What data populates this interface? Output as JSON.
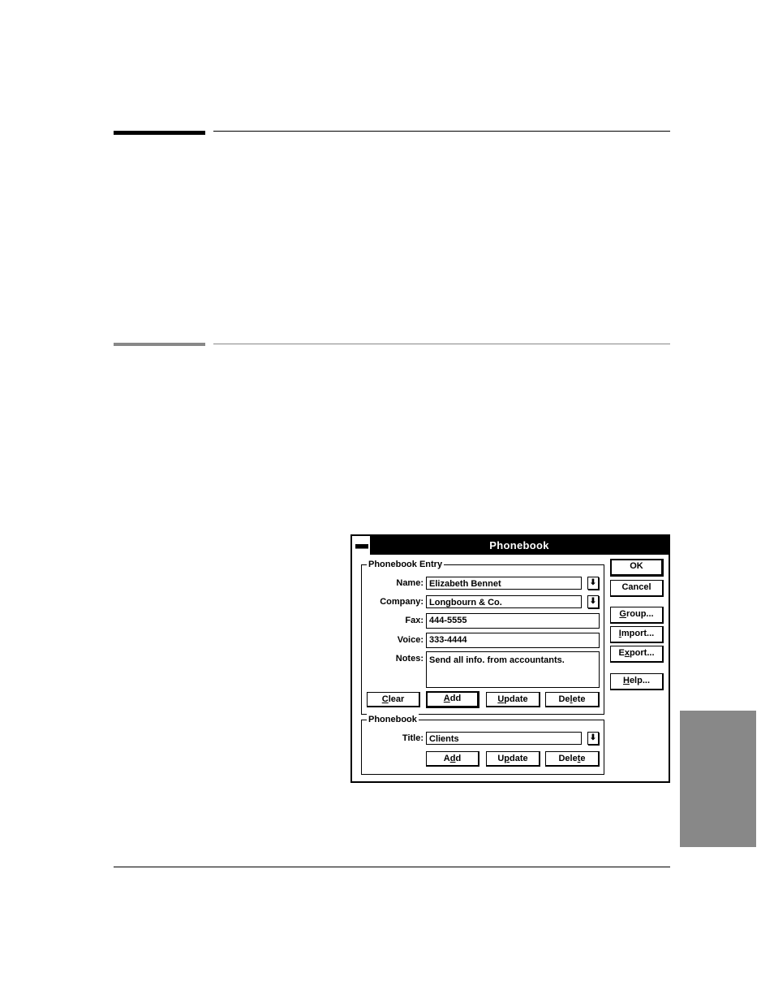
{
  "dialog": {
    "title": "Phonebook",
    "system_menu_icon": "minus-bar-icon",
    "entry_group": {
      "label": "Phonebook Entry",
      "fields": {
        "name": {
          "label": "Name:",
          "value": "Elizabeth Bennet",
          "dropdown_icon": "down-arrow-icon"
        },
        "company": {
          "label": "Company:",
          "value": "Longbourn & Co.",
          "dropdown_icon": "down-arrow-icon"
        },
        "fax": {
          "label": "Fax:",
          "value": "444-5555"
        },
        "voice": {
          "label": "Voice:",
          "value": "333-4444"
        },
        "notes": {
          "label": "Notes:",
          "value": "Send all info. from accountants."
        }
      },
      "buttons": {
        "clear": {
          "pre": "",
          "key": "C",
          "post": "lear"
        },
        "add": {
          "pre": "",
          "key": "A",
          "post": "dd"
        },
        "update": {
          "pre": "",
          "key": "U",
          "post": "pdate"
        },
        "delete": {
          "pre": "De",
          "key": "l",
          "post": "ete"
        }
      }
    },
    "phonebook_group": {
      "label": "Phonebook",
      "title_field": {
        "label": "Title:",
        "value": "Clients",
        "dropdown_icon": "down-arrow-icon"
      },
      "buttons": {
        "add": {
          "pre": "A",
          "key": "d",
          "post": "d"
        },
        "update": {
          "pre": "U",
          "key": "p",
          "post": "date"
        },
        "delete": {
          "pre": "Dele",
          "key": "t",
          "post": "e"
        }
      }
    },
    "side_buttons": {
      "ok": {
        "pre": "OK",
        "key": "",
        "post": ""
      },
      "cancel": {
        "pre": "Cancel",
        "key": "",
        "post": ""
      },
      "group": {
        "pre": "",
        "key": "G",
        "post": "roup..."
      },
      "import": {
        "pre": "",
        "key": "I",
        "post": "mport..."
      },
      "export": {
        "pre": "E",
        "key": "x",
        "post": "port..."
      },
      "help": {
        "pre": "",
        "key": "H",
        "post": "elp..."
      }
    },
    "dropdown_glyph": "⬇"
  }
}
